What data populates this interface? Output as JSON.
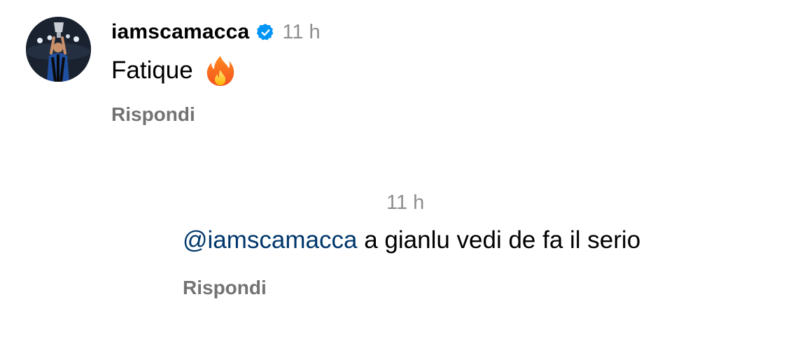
{
  "comment": {
    "username": "iamscamacca",
    "verified": true,
    "time": "11 h",
    "text": "Fatique",
    "emoji": "fire-emoji",
    "reply_label": "Rispondi"
  },
  "reply": {
    "time": "11 h",
    "mention": "@iamscamacca",
    "text": " a gianlu vedi de fa il serio",
    "reply_label": "Rispondi"
  },
  "colors": {
    "verified_blue": "#0095f6",
    "secondary_text": "#8e8e8e",
    "reply_label": "#737373",
    "mention": "#00376b"
  }
}
